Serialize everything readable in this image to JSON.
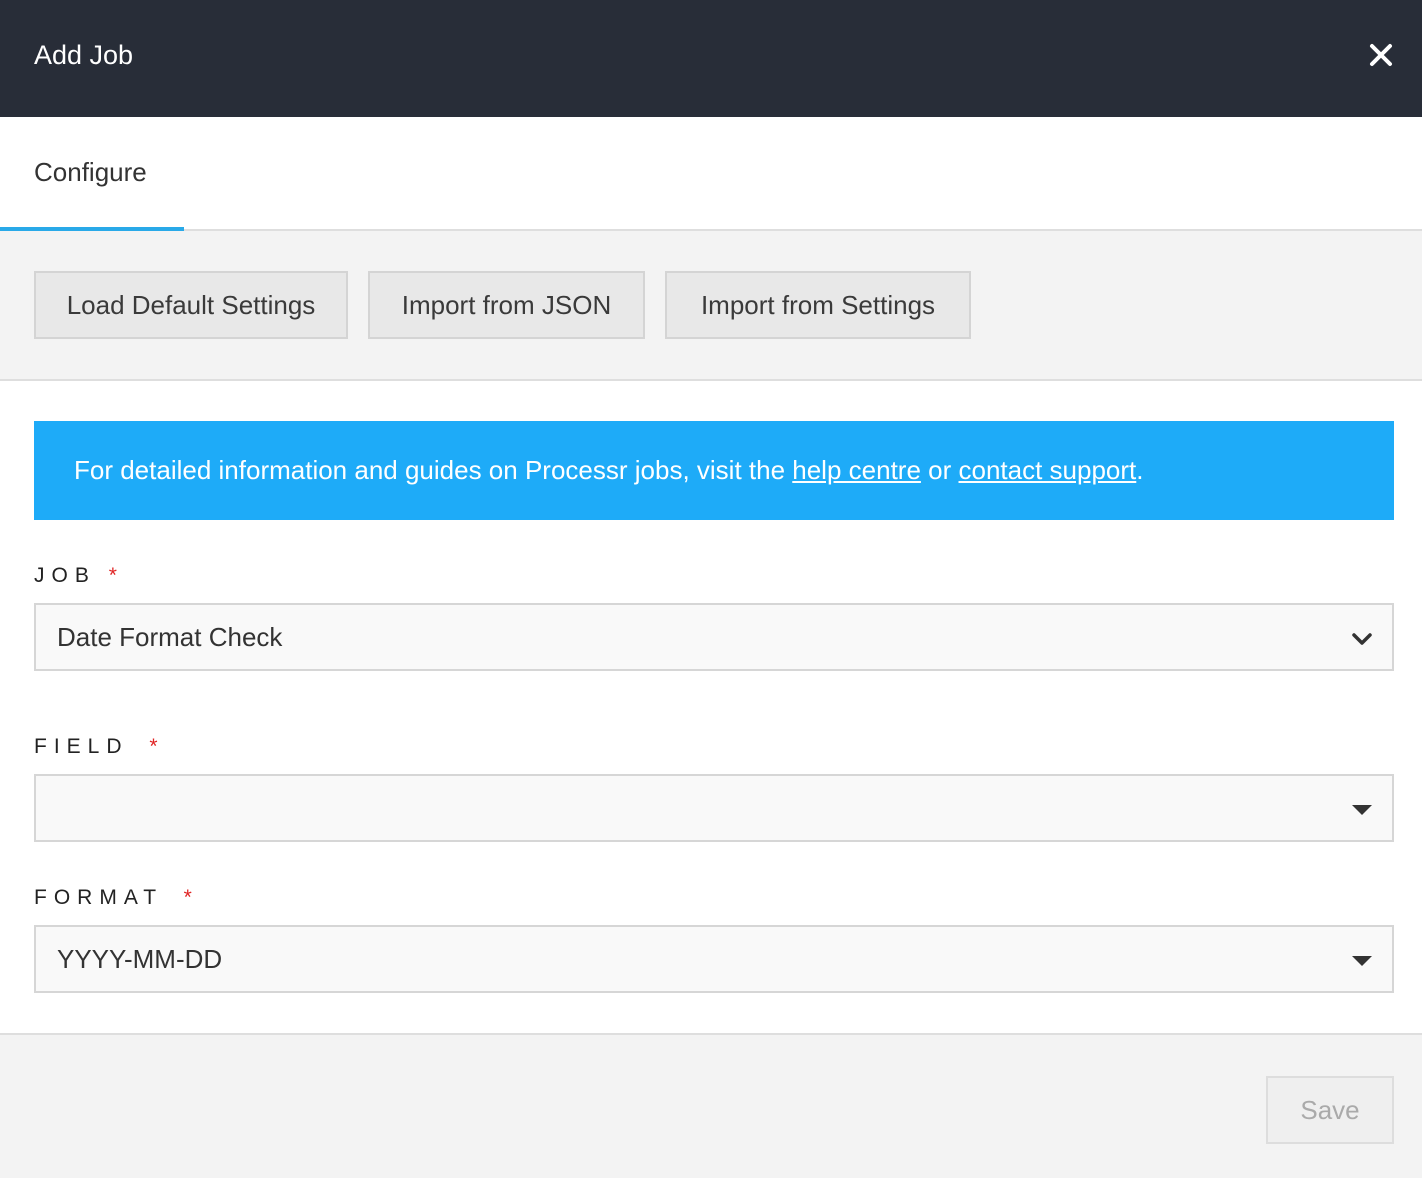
{
  "dialog": {
    "title": "Add Job",
    "close_icon": "close-icon"
  },
  "tabs": [
    {
      "label": "Configure",
      "active": true
    }
  ],
  "toolbar": {
    "buttons": [
      {
        "label": "Load Default Settings"
      },
      {
        "label": "Import from JSON"
      },
      {
        "label": "Import from Settings"
      }
    ]
  },
  "banner": {
    "text_before": "For detailed information and guides on Processr jobs, visit the ",
    "link1": "help centre",
    "text_middle": " or ",
    "link2": "contact support",
    "text_after": ".",
    "color": "#1eabf8"
  },
  "form": {
    "job": {
      "label": "JOB",
      "required_mark": "*",
      "value": "Date Format Check",
      "icon": "chevron-down-icon"
    },
    "field": {
      "label": "FIELD",
      "required_mark": "*",
      "value": "",
      "icon": "caret-down-icon"
    },
    "format": {
      "label": "FORMAT",
      "required_mark": "*",
      "value": "YYYY-MM-DD",
      "icon": "caret-down-icon"
    }
  },
  "footer": {
    "save_label": "Save",
    "save_enabled": false
  },
  "colors": {
    "header_bg": "#282d38",
    "accent": "#29a9e8",
    "required": "#e02525"
  }
}
